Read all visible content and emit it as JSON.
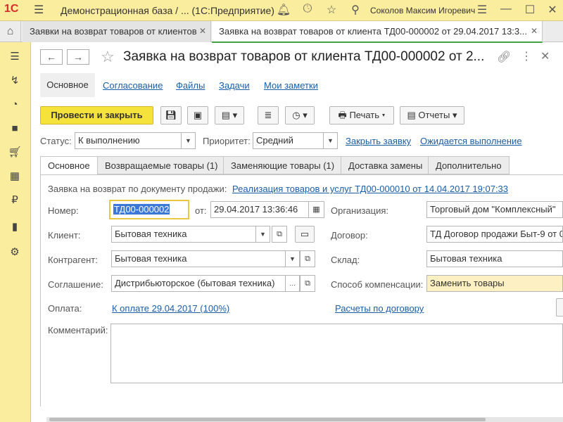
{
  "titlebar": {
    "logo": "1С",
    "app_title": "Демонстрационная база / ...   (1С:Предприятие)",
    "user": "Соколов Максим Игоревич",
    "icons": [
      "bell-icon",
      "history-icon",
      "star-icon",
      "search-icon",
      "menu-icon",
      "minimize-icon",
      "maximize-icon"
    ]
  },
  "tabs": {
    "home_icon": "home-icon",
    "items": [
      {
        "label": "Заявки на возврат товаров от клиентов"
      },
      {
        "label": "Заявка на возврат товаров от клиента ТД00-000002 от 29.04.2017 13:3..."
      }
    ]
  },
  "sidebar": {
    "icons": [
      "menu-icon",
      "chart-arrows-icon",
      "pie-chart-icon",
      "bag-icon",
      "cart-icon",
      "grid-icon",
      "ruble-icon",
      "bar-chart-icon",
      "gear-icon"
    ]
  },
  "header": {
    "title": "Заявка на возврат товаров от клиента ТД00-000002 от 2..."
  },
  "sections": {
    "main": "Основное",
    "links": [
      "Согласование",
      "Файлы",
      "Задачи",
      "Мои заметки"
    ]
  },
  "toolbar": {
    "post_close": "Провести и закрыть",
    "print": "Печать",
    "reports": "Отчеты"
  },
  "status_row": {
    "status_label": "Статус:",
    "status_value": "К выполнению",
    "priority_label": "Приоритет:",
    "priority_value": "Средний",
    "close_link": "Закрыть заявку",
    "expected_link": "Ожидается выполнение"
  },
  "inner_tabs": [
    "Основное",
    "Возвращаемые товары (1)",
    "Заменяющие товары (1)",
    "Доставка замены",
    "Дополнительно"
  ],
  "form": {
    "basis_label": "Заявка на возврат по документу продажи:",
    "basis_link": "Реализация товаров и услуг ТД00-000010 от 14.04.2017 19:07:33",
    "number_label": "Номер:",
    "number_value": "ТД00-000002",
    "from_label": "от:",
    "date_value": "29.04.2017 13:36:46",
    "org_label": "Организация:",
    "org_value": "Торговый дом \"Комплексный\"",
    "client_label": "Клиент:",
    "client_value": "Бытовая техника",
    "contract_label": "Договор:",
    "contract_value": "ТД Договор продажи Быт-9 от 0",
    "counterparty_label": "Контрагент:",
    "counterparty_value": "Бытовая техника",
    "warehouse_label": "Склад:",
    "warehouse_value": "Бытовая техника",
    "agreement_label": "Соглашение:",
    "agreement_value": "Дистрибьюторское (бытовая техника)",
    "compensation_label": "Способ компенсации:",
    "compensation_value": "Заменить товары",
    "payment_label": "Оплата:",
    "payment_link": "К оплате 29.04.2017 (100%)",
    "settlements_link": "Расчеты по договору",
    "comment_label": "Комментарий:",
    "comment_value": ""
  }
}
